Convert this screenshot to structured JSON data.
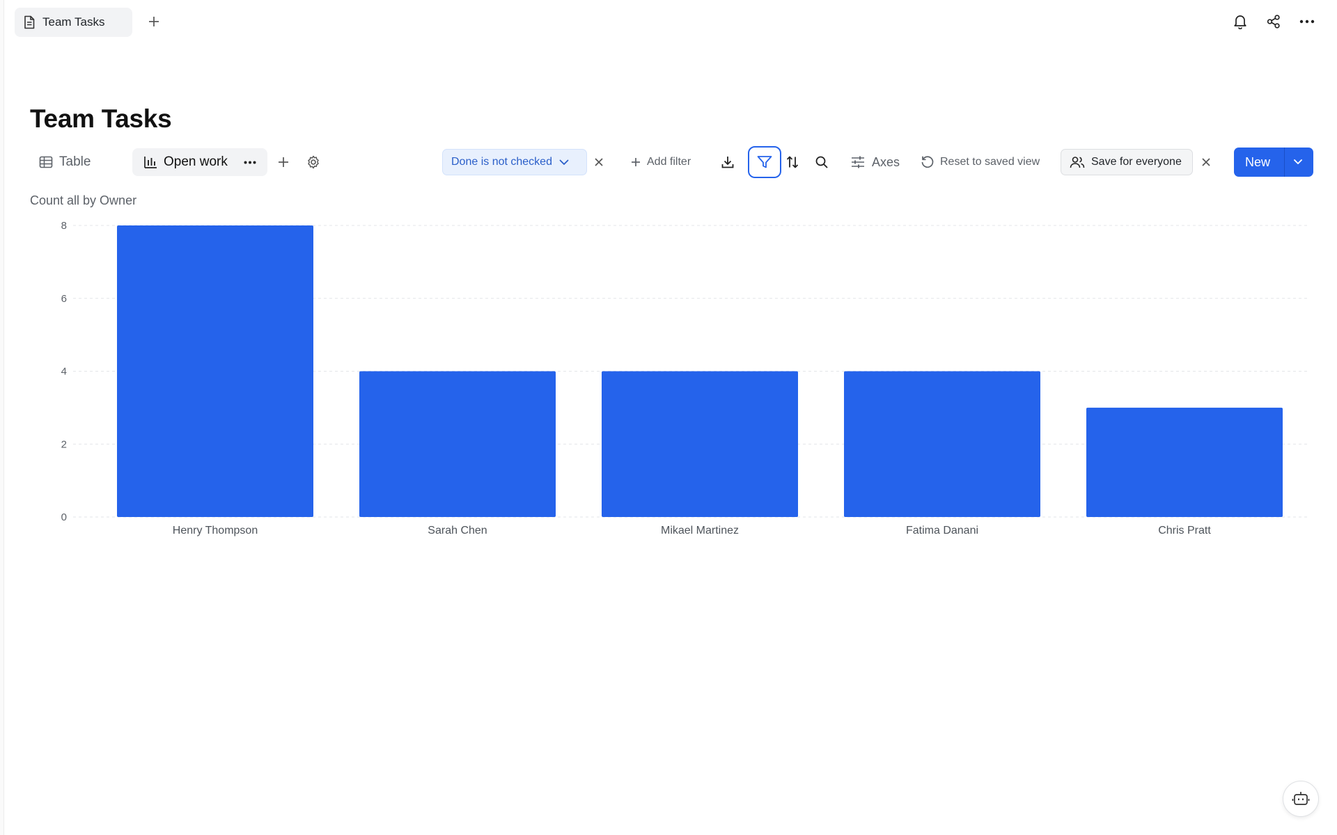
{
  "tabs": {
    "active_tab_label": "Team Tasks",
    "add_tab_icon": "plus-icon"
  },
  "top_actions": {
    "icons": [
      "bell-icon",
      "share-icon",
      "more-horizontal-icon"
    ]
  },
  "page": {
    "title": "Team Tasks"
  },
  "views": {
    "table_label": "Table",
    "active_view_label": "Open work"
  },
  "filter": {
    "chip_label": "Done is not checked",
    "add_filter_label": "Add filter"
  },
  "toolbar": {
    "axes_label": "Axes",
    "reset_label": "Reset to saved view",
    "save_label": "Save for everyone",
    "new_label": "New"
  },
  "colors": {
    "accent": "#2563eb",
    "filter_chip_bg": "#e8f0fd",
    "filter_chip_text": "#2b5fc9"
  },
  "chart_data": {
    "type": "bar",
    "title": "Count all by Owner",
    "categories": [
      "Henry Thompson",
      "Sarah Chen",
      "Mikael Martinez",
      "Fatima Danani",
      "Chris Pratt"
    ],
    "values": [
      8,
      4,
      4,
      4,
      3
    ],
    "ylim": [
      0,
      8
    ],
    "yticks": [
      0,
      2,
      4,
      6,
      8
    ],
    "grid": true
  }
}
